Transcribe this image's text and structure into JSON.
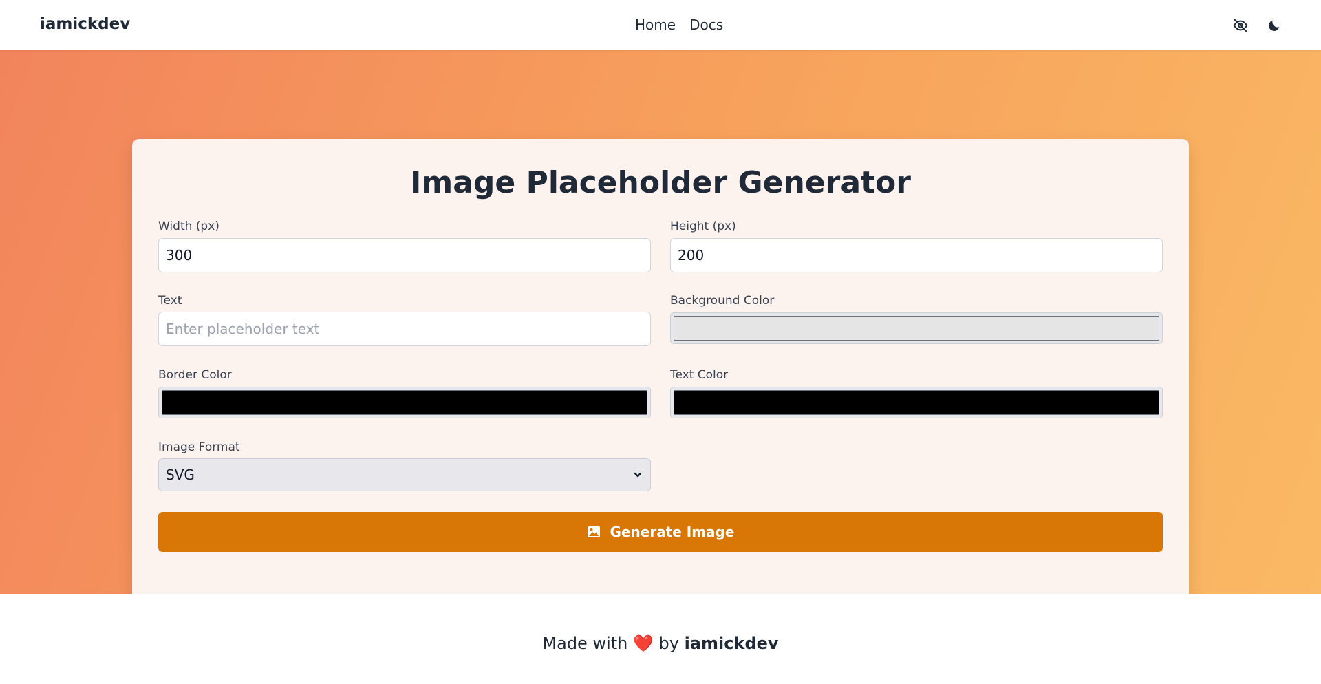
{
  "navbar": {
    "brand": "iamickdev",
    "links": [
      {
        "label": "Home"
      },
      {
        "label": "Docs"
      }
    ],
    "icons": [
      "eye-slash-icon",
      "moon-icon"
    ]
  },
  "form": {
    "title": "Image Placeholder Generator",
    "width": {
      "label": "Width (px)",
      "value": "300"
    },
    "height": {
      "label": "Height (px)",
      "value": "200"
    },
    "text": {
      "label": "Text",
      "value": "",
      "placeholder": "Enter placeholder text"
    },
    "background_color": {
      "label": "Background Color",
      "value": "#e5e5e5"
    },
    "border_color": {
      "label": "Border Color",
      "value": "#000000"
    },
    "text_color": {
      "label": "Text Color",
      "value": "#000000"
    },
    "format": {
      "label": "Image Format",
      "value": "SVG"
    },
    "generate_label": "Generate Image"
  },
  "footer": {
    "prefix": "Made with",
    "heart": "❤️",
    "middle": "by",
    "author": "iamickdev"
  },
  "colors": {
    "accent": "#d97706",
    "gradient_start": "#f2845c",
    "gradient_end": "#fab964",
    "card_bg": "#fdf3ee"
  }
}
